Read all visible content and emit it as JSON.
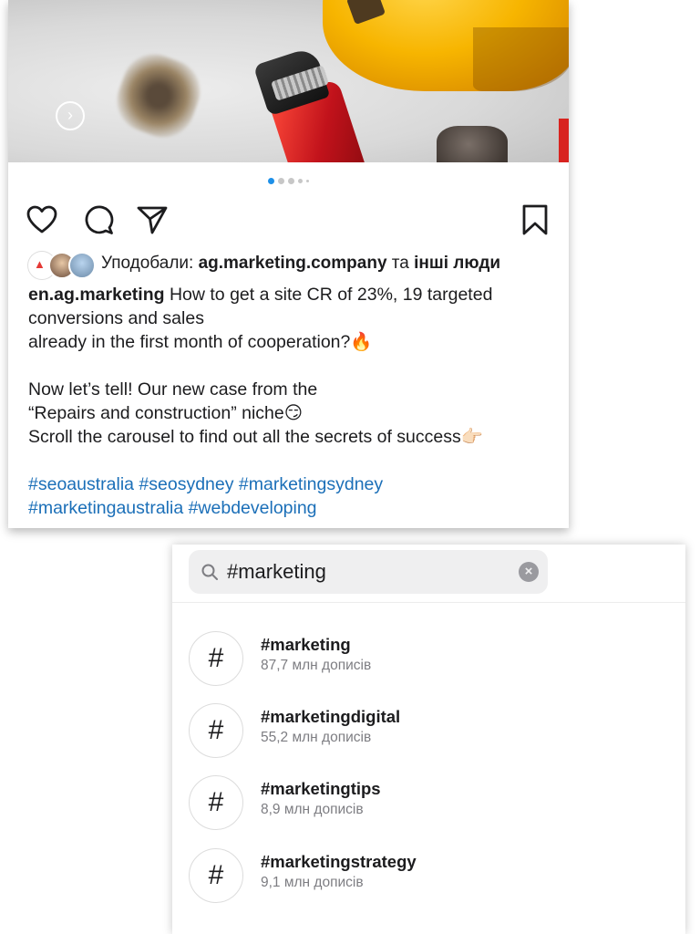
{
  "post": {
    "likes": {
      "prefix": "Уподобали: ",
      "user": "ag.marketing.company",
      "conj": " та ",
      "others": "інші люди"
    },
    "caption": {
      "author": "en.ag.marketing",
      "line1": " How to get a site CR of 23%, 19 targeted",
      "line2": "conversions and sales",
      "line3": "already in the first month of cooperation?🔥",
      "line4": "Now let’s tell! Our new case from the",
      "line5": "“Repairs and construction” niche😏",
      "line6": "Scroll the carousel to find out all the secrets of success👉🏻"
    },
    "hashtags": {
      "line1": "#seoaustralia #seosydney #marketingsydney",
      "line2": "#marketingaustralia #webdeveloping"
    },
    "carousel": {
      "current": 1,
      "total": 5
    },
    "icons": [
      "heart-icon",
      "comment-icon",
      "share-icon",
      "bookmark-icon",
      "chevron-right-icon"
    ]
  },
  "search": {
    "query": "#marketing",
    "results": [
      {
        "tag": "#marketing",
        "count": "87,7 млн дописів"
      },
      {
        "tag": "#marketingdigital",
        "count": "55,2 млн дописів"
      },
      {
        "tag": "#marketingtips",
        "count": "8,9 млн дописів"
      },
      {
        "tag": "#marketingstrategy",
        "count": "9,1 млн дописів"
      }
    ]
  },
  "colors": {
    "link": "#1b6fb8",
    "active_dot": "#1e90e8",
    "muted": "#7d7d82"
  }
}
